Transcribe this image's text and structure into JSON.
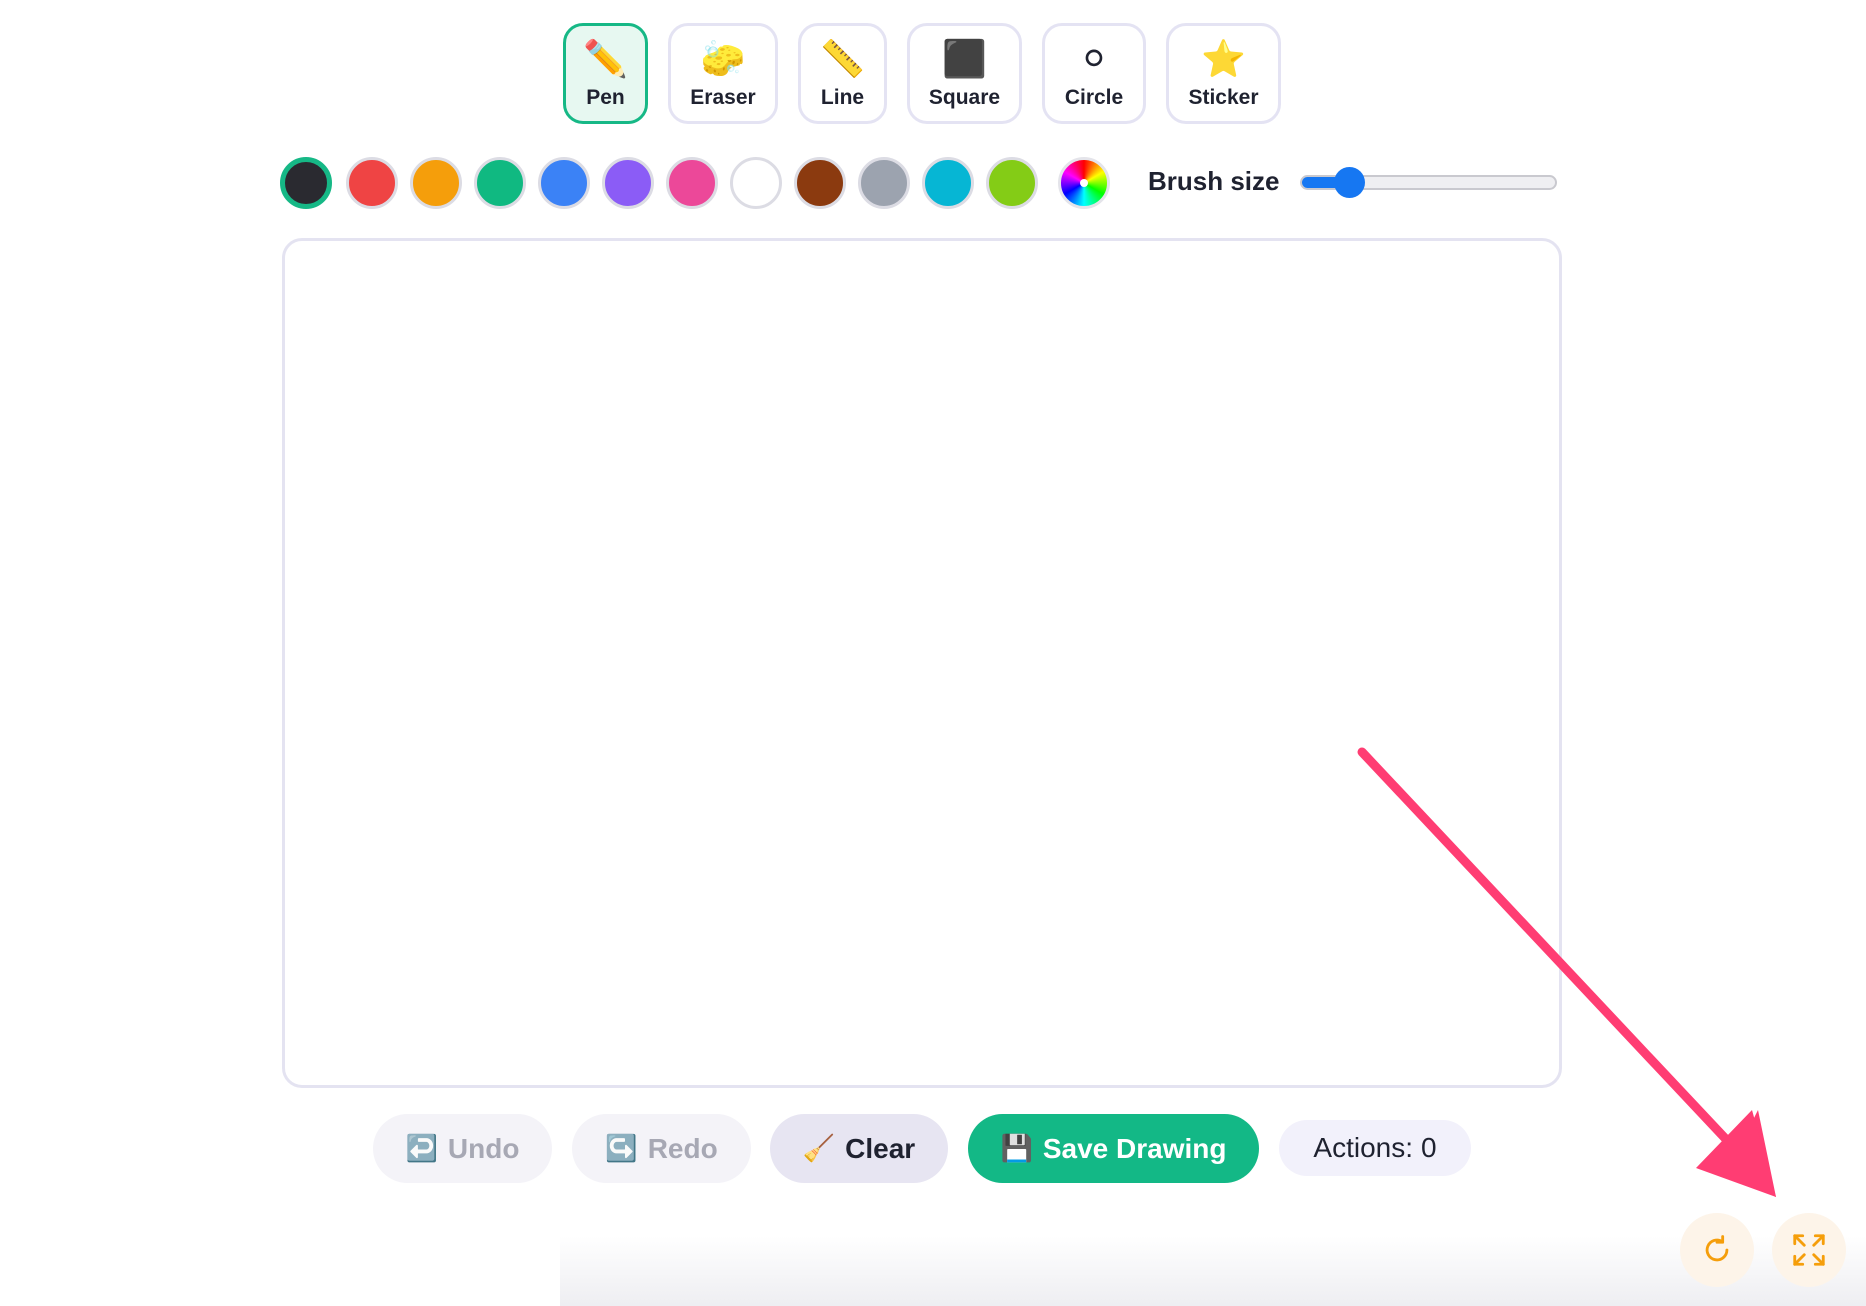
{
  "tools": [
    {
      "label": "Pen",
      "icon": "pencil-icon",
      "glyph": "✏️",
      "active": true
    },
    {
      "label": "Eraser",
      "icon": "sponge-icon",
      "glyph": "🧽",
      "active": false
    },
    {
      "label": "Line",
      "icon": "ruler-icon",
      "glyph": "📏",
      "active": false
    },
    {
      "label": "Square",
      "icon": "black-square-icon",
      "glyph": "⬛",
      "active": false
    },
    {
      "label": "Circle",
      "icon": "white-circle-icon",
      "glyph": "⚪",
      "active": false
    },
    {
      "label": "Sticker",
      "icon": "star-icon",
      "glyph": "⭐",
      "active": false
    }
  ],
  "palette": {
    "colors": [
      "#2a2a30",
      "#ef4444",
      "#f59e0b",
      "#10b981",
      "#3b82f6",
      "#8b5cf6",
      "#ec4899",
      "#ffffff",
      "#8b3a0f",
      "#9ca3af",
      "#06b6d4",
      "#84cc16"
    ],
    "selected_index": 0,
    "custom_picker_icon": "rainbow-color-wheel-icon"
  },
  "brush": {
    "label": "Brush size",
    "level_fraction": 0.15,
    "accent_color": "#1677f2"
  },
  "actions": {
    "undo": {
      "label": "Undo",
      "icon": "undo-arrow-icon",
      "glyph": "↩️"
    },
    "redo": {
      "label": "Redo",
      "icon": "redo-arrow-icon",
      "glyph": "↪️"
    },
    "clear": {
      "label": "Clear",
      "icon": "broom-icon",
      "glyph": "🧹"
    },
    "save": {
      "label": "Save Drawing",
      "icon": "floppy-disk-icon",
      "glyph": "💾"
    },
    "count_label": "Actions:",
    "count_value": "0"
  },
  "corner": {
    "refresh_icon": "refresh-icon",
    "expand_icon": "fullscreen-expand-icon",
    "icon_color": "#f59e0b"
  },
  "annotation": {
    "arrow_icon": "pointer-arrow-icon",
    "arrow_color": "#ff3d73"
  },
  "colors": {
    "accent": "#16b886",
    "save_bg": "#13b886"
  }
}
